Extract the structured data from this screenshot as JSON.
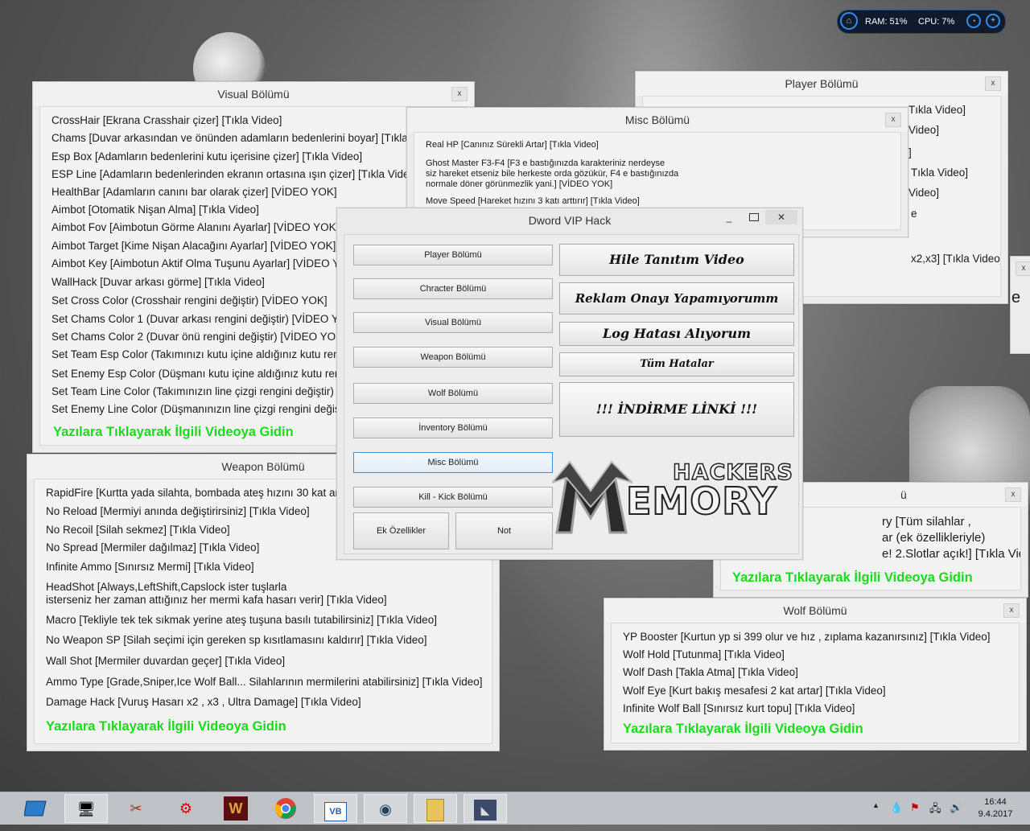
{
  "tray_widget": {
    "ram": "RAM: 51%",
    "cpu": "CPU: 7%"
  },
  "visual_window": {
    "title": "Visual Bölümü",
    "close": "x",
    "lines": [
      "CrossHair [Ekrana Crasshair çizer] [Tıkla Video]",
      "Chams [Duvar arkasından ve önünden adamların bedenlerini boyar] [Tıkla",
      "Esp Box [Adamların bedenlerini kutu içerisine çizer] [Tıkla Video]",
      "ESP Line [Adamların bedenlerinden ekranın ortasına ışın çizer] [Tıkla Video",
      "HealthBar [Adamların canını bar olarak çizer] [VİDEO YOK]",
      "Aimbot [Otomatik Nişan Alma] [Tıkla Video]",
      "Aimbot Fov [Aimbotun Görme Alanını Ayarlar] [VİDEO YOK]",
      "Aimbot Target [Kime Nişan Alacağını Ayarlar] [VİDEO YOK]",
      "Aimbot Key [Aimbotun Aktif Olma Tuşunu Ayarlar] [VİDEO Y",
      "WallHack [Duvar arkası görme] [Tıkla Video]",
      "Set Cross Color (Crosshair rengini değiştir) [VİDEO YOK]",
      "Set Chams Color 1 (Duvar arkası rengini değiştir) [VİDEO YO",
      "Set Chams Color 2 (Duvar önü rengini değiştir) [VİDEO YOK]",
      "Set Team Esp Color (Takımınızı kutu içine aldığınız kutu reng",
      "Set Enemy Esp Color (Düşmanı kutu içine aldığınız kutu reng",
      "Set Team Line Color (Takımınızın line çizgi rengini değiştir) [V",
      "Set Enemy Line Color (Düşmanınızın line çizgi rengini değişti"
    ],
    "footer": "Yazılara Tıklayarak İlgili Videoya Gidin"
  },
  "misc_window": {
    "title": "Misc Bölümü",
    "close": "x",
    "line1": "Real HP [Canınız Sürekli Artar] [Tıkla Video]",
    "line2a": "Ghost Master F3-F4 [F3 e bastığınızda karakteriniz nerdeyse",
    "line2b": "siz hareket etseniz bile herkeste orda gözükür, F4 e bastığınızda",
    "line2c": "normale döner görünmezlik yani.] [VİDEO YOK]",
    "line3": "Move Speed [Hareket hızını 3 katı arttırır] [Tıkla Video]"
  },
  "player_window": {
    "title": "Player Bölümü",
    "close": "x",
    "lines": [
      "Tıkla Video]",
      "Video]",
      "]",
      "Tıkla Video]",
      "Video]",
      "e",
      "x2,x3] [Tıkla Video]"
    ]
  },
  "weapon_window": {
    "title": "Weapon Bölümü",
    "lines": [
      "RapidFire [Kurtta yada silahta, bombada ateş hızını 30 kat arttı",
      "No Reload [Mermiyi anında değiştirirsiniz] [Tıkla Video]",
      "No Recoil [Silah sekmez] [Tıkla Video]",
      "No Spread [Mermiler dağılmaz] [Tıkla Video]",
      "Infinite Ammo [Sınırsız Mermi] [Tıkla Video]",
      "HeadShot [Always,LeftShift,Capslock ister tuşlarla",
      "isterseniz her zaman attığınız her mermi kafa hasarı verir] [Tıkla Video]",
      "Macro [Tekliyle tek tek sıkmak yerine ateş tuşuna basılı tutabilirsiniz] [Tıkla Video]",
      "No Weapon SP [Silah seçimi için gereken sp kısıtlamasını kaldırır] [Tıkla Video]",
      "Wall Shot [Mermiler duvardan geçer] [Tıkla Video]",
      "Ammo Type [Grade,Sniper,Ice Wolf Ball... Silahlarının mermilerini atabilirsiniz] [Tıkla Video]",
      "Damage Hack [Vuruş Hasarı x2 , x3 , Ultra Damage] [Tıkla Video]"
    ],
    "footer": "Yazılara Tıklayarak İlgili Videoya Gidin"
  },
  "inventory_window": {
    "title": "ü",
    "close": "x",
    "line1": "ry [Tüm silahlar ,",
    "line2": "ar (ek özellikleriyle)",
    "line3": "e! 2.Slotlar açık!]  [Tıkla Video]",
    "footer": "Yazılara Tıklayarak İlgili Videoya Gidin"
  },
  "wolf_window": {
    "title": "Wolf Bölümü",
    "close": "x",
    "lines": [
      "YP Booster [Kurtun yp si 399 olur ve hız  , zıplama kazanırsınız] [Tıkla Video]",
      "Wolf Hold [Tutunma] [Tıkla Video]",
      "Wolf Dash [Takla Atma] [Tıkla Video]",
      "Wolf Eye [Kurt bakış mesafesi 2 kat artar] [Tıkla Video]",
      "Infinite Wolf Ball [Sınırsız kurt topu] [Tıkla Video]"
    ],
    "footer": "Yazılara Tıklayarak İlgili Videoya Gidin"
  },
  "edge_window": {
    "close": "x",
    "text": "e"
  },
  "main_app": {
    "title": "Dword VIP Hack",
    "minimize": "_",
    "close": "✕",
    "left_buttons": [
      "Player Bölümü",
      "Chracter Bölümü",
      "Visual Bölümü",
      "Weapon Bölümü",
      "Wolf Bölümü",
      "İnventory Bölümü",
      "Misc Bölümü",
      "Kill - Kick Bölümü"
    ],
    "ek_label": "Ek Özellikler",
    "not_label": "Not",
    "right_buttons": [
      "Hile Tanıtım Video",
      "Reklam Onayı Yapamıyorumm",
      "Log Hatası Alıyorum",
      "Tüm Hatalar",
      "!!! İNDİRME LİNKİ !!!"
    ],
    "logo_top": "HACKERS",
    "logo_bottom": "EMORY"
  },
  "taskbar": {
    "time": "16:44",
    "date": "9.4.2017"
  }
}
